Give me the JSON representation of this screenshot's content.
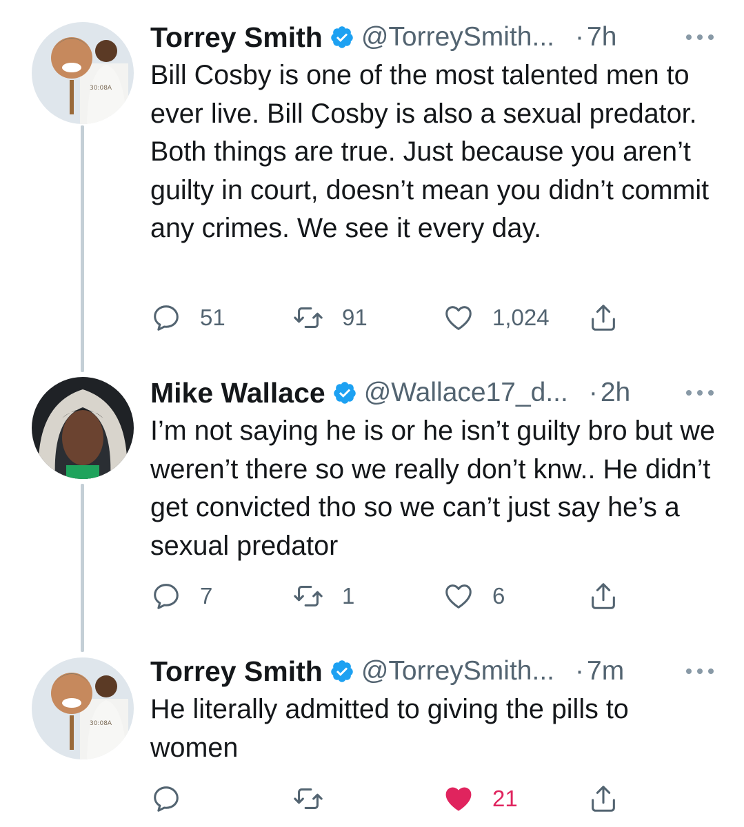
{
  "colors": {
    "verified": "#1da1f2",
    "secondary_text": "#536471",
    "like_active": "#e0245e",
    "thread_line": "#c4cfd6"
  },
  "tweets": [
    {
      "name": "Torrey Smith",
      "handle": "@TorreySmith...",
      "time": "7h",
      "dot": "·",
      "verified": true,
      "text": "Bill Cosby is one of the most talented men to ever live. Bill Cosby is also a sexual predator. Both things are true. Just because you aren’t guilty in court, doesn’t mean you didn’t commit any crimes. We see it every day.",
      "replies": "51",
      "retweets": "91",
      "likes": "1,024",
      "liked": false
    },
    {
      "name": "Mike Wallace",
      "handle": "@Wallace17_d...",
      "time": "2h",
      "dot": "·",
      "verified": true,
      "text": "I’m not saying he is or he isn’t guilty bro but we weren’t there so we really don’t knw..  He didn’t get convicted tho so we can’t just say he’s a sexual predator",
      "replies": "7",
      "retweets": "1",
      "likes": "6",
      "liked": false
    },
    {
      "name": "Torrey Smith",
      "handle": "@TorreySmith...",
      "time": "7m",
      "dot": "·",
      "verified": true,
      "text": "He literally admitted to giving the pills to women",
      "replies": "",
      "retweets": "",
      "likes": "21",
      "liked": true
    }
  ]
}
